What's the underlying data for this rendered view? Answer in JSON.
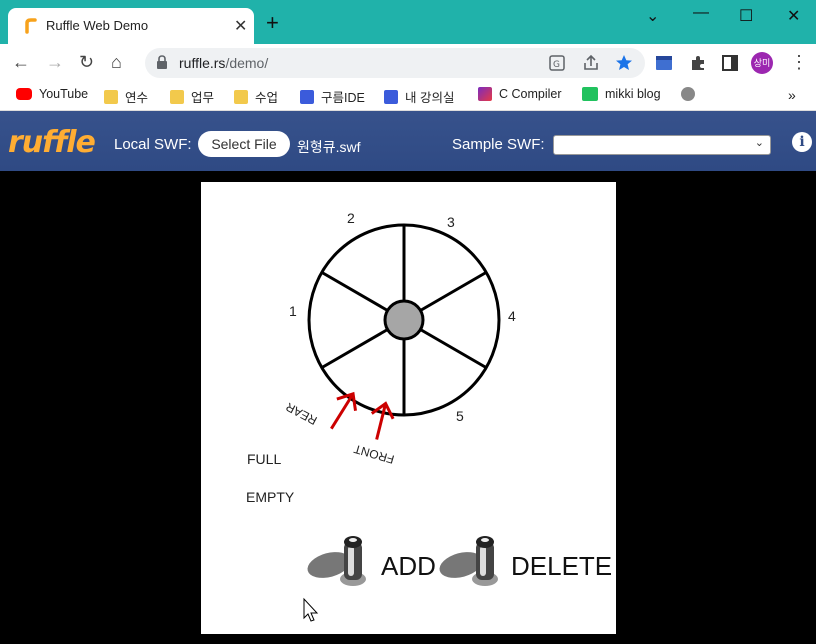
{
  "browser": {
    "tab_title": "Ruffle Web Demo",
    "url_host": "ruffle.rs",
    "url_path": "/demo/",
    "profile_label": "상미"
  },
  "bookmarks": [
    {
      "label": "YouTube",
      "icon": "youtube-icon",
      "color": "#ff0000"
    },
    {
      "label": "연수",
      "icon": "folder-icon",
      "color": "#f2c94c"
    },
    {
      "label": "업무",
      "icon": "folder-icon",
      "color": "#f2c94c"
    },
    {
      "label": "수업",
      "icon": "folder-icon",
      "color": "#f2c94c"
    },
    {
      "label": "구름IDE",
      "icon": "goorm-icon",
      "color": "#3b5bdb"
    },
    {
      "label": "내 강의실",
      "icon": "goorm-icon",
      "color": "#3b5bdb"
    },
    {
      "label": "C Compiler",
      "icon": "compiler-icon",
      "color": "#7b2cbf"
    },
    {
      "label": "mikki blog",
      "icon": "blog-icon",
      "color": "#21c25e"
    }
  ],
  "ruffle": {
    "logo": "ruffle",
    "local_swf_label": "Local SWF:",
    "select_file_label": "Select File",
    "file_name": "원형큐.swf",
    "sample_swf_label": "Sample SWF:",
    "sample_selected": "",
    "info_symbol": "i"
  },
  "stage": {
    "slot_numbers": [
      "1",
      "2",
      "3",
      "4",
      "5"
    ],
    "rear_label": "REAR",
    "front_label": "FRONT",
    "full_label": "FULL",
    "empty_label": "EMPTY",
    "add_label": "ADD",
    "delete_label": "DELETE",
    "arrow_color": "#cc0000"
  }
}
